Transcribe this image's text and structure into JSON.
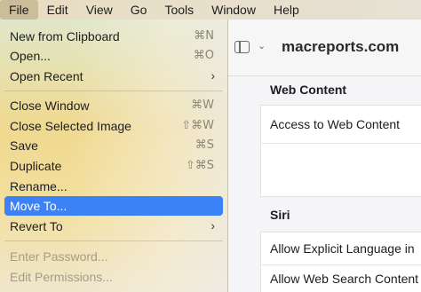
{
  "menubar": {
    "items": [
      "File",
      "Edit",
      "View",
      "Go",
      "Tools",
      "Window",
      "Help"
    ],
    "active_index": 0
  },
  "file_menu": {
    "items": [
      {
        "label": "New from Clipboard",
        "shortcut": "⌘N",
        "submenu": false,
        "disabled": false,
        "highlighted": false
      },
      {
        "label": "Open...",
        "shortcut": "⌘O",
        "submenu": false,
        "disabled": false,
        "highlighted": false
      },
      {
        "label": "Open Recent",
        "shortcut": "",
        "submenu": true,
        "disabled": false,
        "highlighted": false
      },
      {
        "label": "Close Window",
        "shortcut": "⌘W",
        "submenu": false,
        "disabled": false,
        "highlighted": false
      },
      {
        "label": "Close Selected Image",
        "shortcut": "⇧⌘W",
        "submenu": false,
        "disabled": false,
        "highlighted": false
      },
      {
        "label": "Save",
        "shortcut": "⌘S",
        "submenu": false,
        "disabled": false,
        "highlighted": false
      },
      {
        "label": "Duplicate",
        "shortcut": "⇧⌘S",
        "submenu": false,
        "disabled": false,
        "highlighted": false
      },
      {
        "label": "Rename...",
        "shortcut": "",
        "submenu": false,
        "disabled": false,
        "highlighted": false
      },
      {
        "label": "Move To...",
        "shortcut": "",
        "submenu": false,
        "disabled": false,
        "highlighted": true
      },
      {
        "label": "Revert To",
        "shortcut": "",
        "submenu": true,
        "disabled": false,
        "highlighted": false
      },
      {
        "label": "Enter Password...",
        "shortcut": "",
        "submenu": false,
        "disabled": true,
        "highlighted": false
      },
      {
        "label": "Edit Permissions...",
        "shortcut": "",
        "submenu": false,
        "disabled": true,
        "highlighted": false
      }
    ],
    "submenu_arrow": "›"
  },
  "browser": {
    "page_title": "macreports.com",
    "sections": [
      {
        "header": "Web Content",
        "rows": [
          "Access to Web Content"
        ]
      },
      {
        "header": "Siri",
        "rows": [
          "Allow Explicit Language in",
          "Allow Web Search Content"
        ]
      }
    ]
  },
  "icons": {
    "sidebar": "sidebar-toggle-icon",
    "chevron": "chevron-down-icon",
    "submenu": "chevron-right-icon"
  },
  "colors": {
    "highlight": "#3b82f6",
    "disabled_text": "#a49c89"
  }
}
